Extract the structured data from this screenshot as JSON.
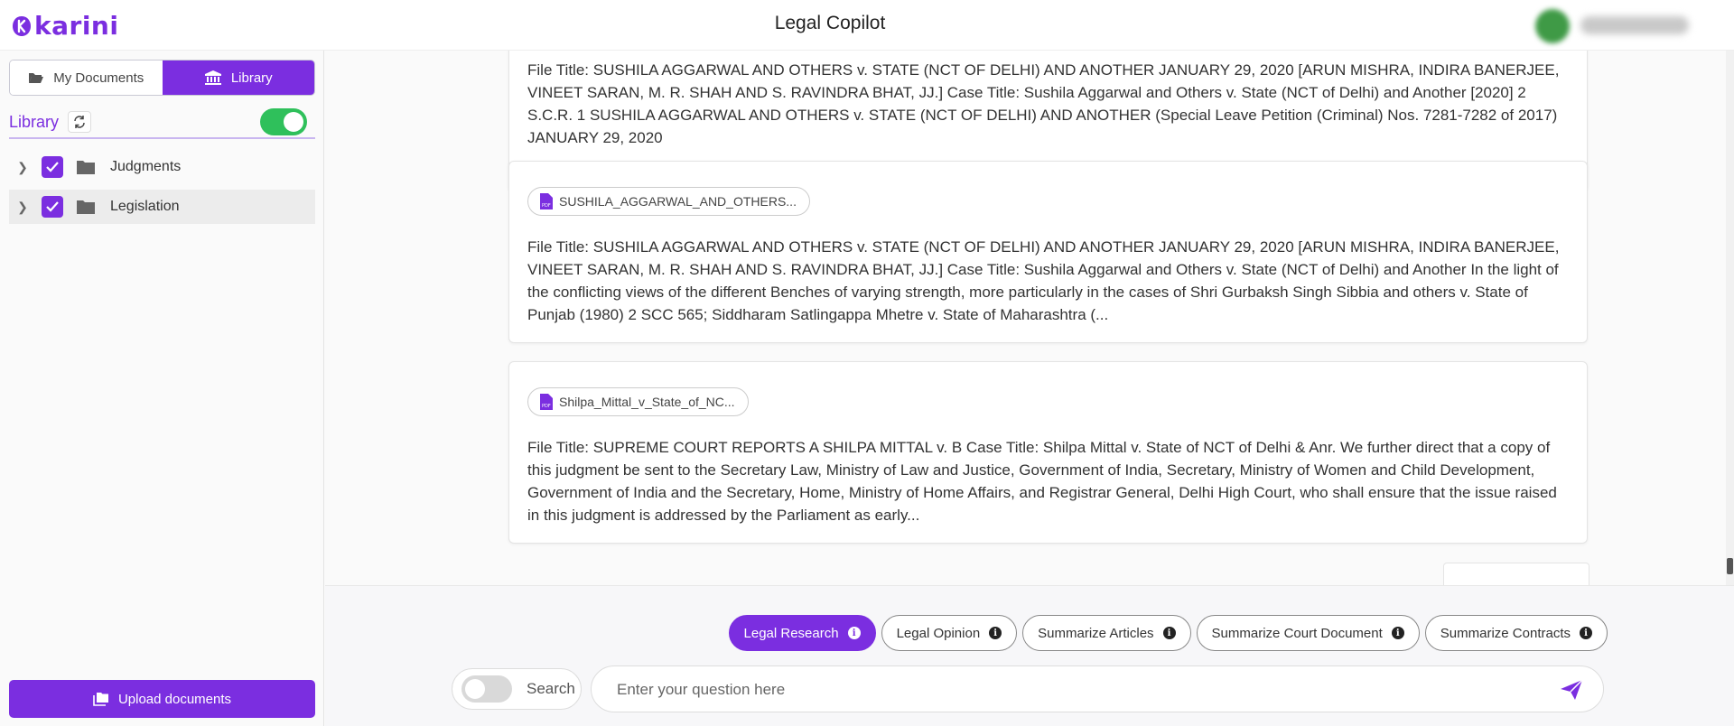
{
  "header": {
    "logo_text": "karini",
    "title": "Legal Copilot"
  },
  "sidebar": {
    "tabs": [
      {
        "label": "My Documents",
        "icon": "folder-open-icon",
        "active": false
      },
      {
        "label": "Library",
        "icon": "bank-icon",
        "active": true
      }
    ],
    "library_title": "Library",
    "library_toggle_on": true,
    "tree": [
      {
        "label": "Judgments",
        "checked": true
      },
      {
        "label": "Legislation",
        "checked": true
      }
    ],
    "upload_label": "Upload documents"
  },
  "results": [
    {
      "chip": "",
      "text": "File Title: SUSHILA AGGARWAL AND OTHERS v. STATE (NCT OF DELHI) AND ANOTHER JANUARY 29, 2020 [ARUN MISHRA, INDIRA BANERJEE, VINEET SARAN, M. R. SHAH AND S. RAVINDRA BHAT, JJ.] Case Title: Sushila Aggarwal and Others v. State (NCT of Delhi) and Another [2020] 2 S.C.R. 1 SUSHILA AGGARWAL AND OTHERS v. STATE (NCT OF DELHI) AND ANOTHER (Special Leave Petition (Criminal) Nos. 7281-7282 of 2017) JANUARY 29, 2020"
    },
    {
      "chip": "SUSHILA_AGGARWAL_AND_OTHERS...",
      "text": "File Title: SUSHILA AGGARWAL AND OTHERS v. STATE (NCT OF DELHI) AND ANOTHER JANUARY 29, 2020 [ARUN MISHRA, INDIRA BANERJEE, VINEET SARAN, M. R. SHAH AND S. RAVINDRA BHAT, JJ.] Case Title: Sushila Aggarwal and Others v. State (NCT of Delhi) and Another In the light of the conflicting views of the different Benches of varying strength, more particularly in the cases of Shri Gurbaksh Singh Sibbia and others v. State of Punjab (1980) 2 SCC 565; Siddharam Satlingappa Mhetre v. State of Maharashtra (..."
    },
    {
      "chip": "Shilpa_Mittal_v_State_of_NC...",
      "text": "File Title: SUPREME COURT REPORTS A SHILPA MITTAL v. B Case Title: Shilpa Mittal v. State of NCT of Delhi & Anr. We further direct that a copy of this judgment be sent to the Secretary Law, Ministry of Law and Justice, Government of India, Secretary, Ministry of Women and Child Development, Government of India and the Secretary, Home, Ministry of Home Affairs, and Registrar General, Delhi High Court, who shall ensure that the issue raised in this judgment is addressed by the Parliament as early..."
    }
  ],
  "modes": [
    {
      "label": "Legal Research",
      "active": true
    },
    {
      "label": "Legal Opinion",
      "active": false
    },
    {
      "label": "Summarize Articles",
      "active": false
    },
    {
      "label": "Summarize Court Document",
      "active": false
    },
    {
      "label": "Summarize Contracts",
      "active": false
    }
  ],
  "composer": {
    "search_label": "Search",
    "search_toggle_on": false,
    "placeholder": "Enter your question here"
  },
  "colors": {
    "accent": "#7b2ee0",
    "toggle_on": "#2fc05b"
  }
}
